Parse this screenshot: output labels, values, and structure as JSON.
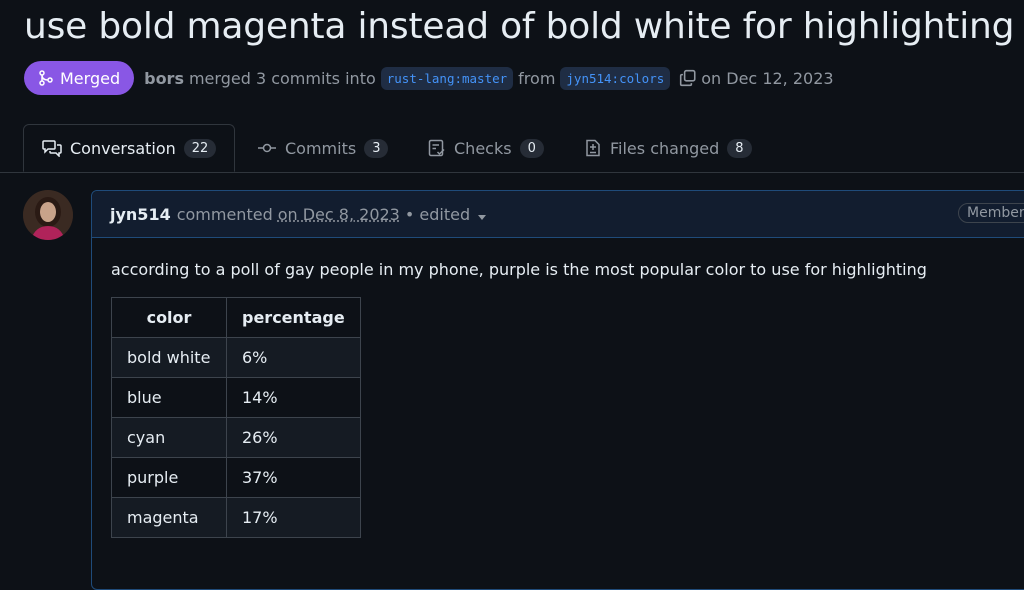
{
  "pr": {
    "title": "use bold magenta instead of bold white for highlighting",
    "state": "Merged",
    "merged_by": "bors",
    "merge_text": "merged 3 commits into",
    "base_branch": "rust-lang:master",
    "from_text": "from",
    "head_branch": "jyn514:colors",
    "date_text": "on Dec 12, 2023"
  },
  "tabs": [
    {
      "label": "Conversation",
      "count": "22",
      "icon": "comment-discussion-icon"
    },
    {
      "label": "Commits",
      "count": "3",
      "icon": "git-commit-icon"
    },
    {
      "label": "Checks",
      "count": "0",
      "icon": "checklist-icon"
    },
    {
      "label": "Files changed",
      "count": "8",
      "icon": "file-diff-icon"
    }
  ],
  "comment": {
    "author": "jyn514",
    "action": "commented",
    "date": "on Dec 8, 2023",
    "edited": "• edited",
    "role": "Member",
    "body": "according to a poll of gay people in my phone, purple is the most popular color to use for highlighting",
    "table": {
      "headers": [
        "color",
        "percentage"
      ],
      "rows": [
        [
          "bold white",
          "6%"
        ],
        [
          "blue",
          "14%"
        ],
        [
          "cyan",
          "26%"
        ],
        [
          "purple",
          "37%"
        ],
        [
          "magenta",
          "17%"
        ]
      ]
    }
  },
  "colors": {
    "background": "#0d1117",
    "merged": "#8957e5",
    "link": "#4493f8",
    "comment_border": "#1f4b7a"
  }
}
